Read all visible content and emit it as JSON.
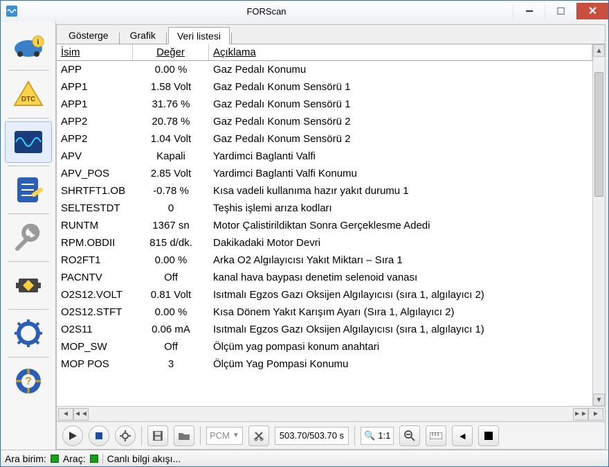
{
  "title": "FORScan",
  "tabs": {
    "gauge": "Gösterge",
    "graph": "Grafik",
    "list": "Veri listesi"
  },
  "columns": {
    "name": "İsim",
    "value": "Değer",
    "desc": "Açıklama"
  },
  "rows": [
    {
      "name": "APP",
      "value": "0.00 %",
      "desc": "Gaz Pedalı Konumu"
    },
    {
      "name": "APP1",
      "value": "1.58 Volt",
      "desc": "Gaz Pedalı Konum Sensörü 1"
    },
    {
      "name": "APP1",
      "value": "31.76 %",
      "desc": "Gaz Pedalı Konum Sensörü 1"
    },
    {
      "name": "APP2",
      "value": "20.78 %",
      "desc": "Gaz Pedalı Konum Sensörü 2"
    },
    {
      "name": "APP2",
      "value": "1.04 Volt",
      "desc": "Gaz Pedalı Konum Sensörü 2"
    },
    {
      "name": "APV",
      "value": "Kapali",
      "desc": "Yardimci Baglanti Valfi"
    },
    {
      "name": "APV_POS",
      "value": "2.85 Volt",
      "desc": "Yardimci Baglanti Valfi Konumu"
    },
    {
      "name": "SHRTFT1.OB",
      "value": "-0.78 %",
      "desc": "Kısa vadeli kullanıma hazır yakıt durumu 1"
    },
    {
      "name": "SELTESTDT",
      "value": "0",
      "desc": "Teşhis işlemi arıza kodları"
    },
    {
      "name": "RUNTM",
      "value": "1367 sn",
      "desc": "Motor Çalistirildiktan Sonra Gerçeklesme Adedi"
    },
    {
      "name": "RPM.OBDII",
      "value": "815 d/dk.",
      "desc": "Dakikadaki Motor Devri"
    },
    {
      "name": "RO2FT1",
      "value": "0.00 %",
      "desc": "Arka O2 Algılayıcısı Yakıt Miktarı – Sıra 1"
    },
    {
      "name": "PACNTV",
      "value": "Off",
      "desc": "kanal hava baypası denetim selenoid vanası"
    },
    {
      "name": "O2S12.VOLT",
      "value": "0.81 Volt",
      "desc": "Isıtmalı Egzos Gazı Oksijen Algılayıcısı (sıra 1, algılayıcı 2)"
    },
    {
      "name": "O2S12.STFT",
      "value": "0.00 %",
      "desc": "Kısa Dönem Yakıt Karışım Ayarı (Sıra 1, Algılayıcı 2)"
    },
    {
      "name": "O2S11",
      "value": "0.06 mA",
      "desc": "Isıtmalı Egzos Gazı Oksijen Algılayıcısı (sıra 1, algılayıcı 1)"
    },
    {
      "name": "MOP_SW",
      "value": "Off",
      "desc": "Ölçüm yag pompasi konum anahtari"
    },
    {
      "name": "MOP POS",
      "value": "3",
      "desc": "Ölçüm Yag Pompasi Konumu"
    }
  ],
  "module_selector": "PCM",
  "time_display": "503.70/503.70 s",
  "zoom_label": "1:1",
  "status": {
    "ara_birim": "Ara birim:",
    "arac": "Araç:",
    "stream": "Canlı bilgi akışı..."
  }
}
